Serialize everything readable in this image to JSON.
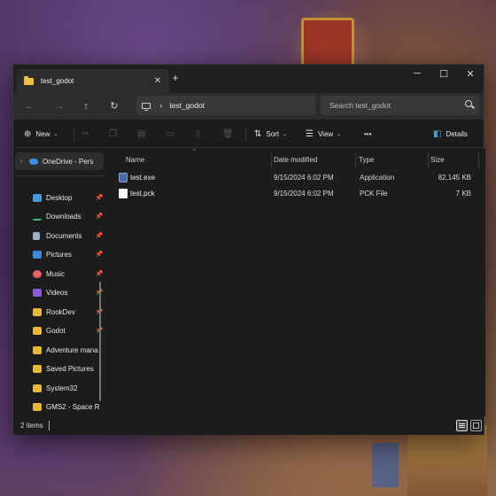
{
  "window": {
    "tab_title": "test_godot",
    "tab_close": "✕",
    "new_tab": "+",
    "minimize": "─",
    "maximize": "☐",
    "close": "✕"
  },
  "navbar": {
    "back": "←",
    "forward": "→",
    "up": "↑",
    "refresh": "↻",
    "breadcrumb_sep": "›",
    "breadcrumb": "test_godot",
    "search_placeholder": "Search test_godot"
  },
  "commandbar": {
    "new_label": "New",
    "sort_label": "Sort",
    "view_label": "View",
    "more_label": "•••",
    "details_label": "Details",
    "caret": "⌄"
  },
  "sidebar": {
    "onedrive": "OneDrive - Pers",
    "items": [
      {
        "label": "Desktop",
        "icon": "desktop-icon",
        "pinned": true
      },
      {
        "label": "Downloads",
        "icon": "downloads-icon",
        "pinned": true
      },
      {
        "label": "Documents",
        "icon": "documents-icon",
        "pinned": true
      },
      {
        "label": "Pictures",
        "icon": "pictures-icon",
        "pinned": true
      },
      {
        "label": "Music",
        "icon": "music-icon",
        "pinned": true
      },
      {
        "label": "Videos",
        "icon": "videos-icon",
        "pinned": true
      },
      {
        "label": "RookDev",
        "icon": "folder-icon",
        "pinned": true
      },
      {
        "label": "Godot",
        "icon": "folder-icon",
        "pinned": true
      },
      {
        "label": "Adventure mana",
        "icon": "folder-icon",
        "pinned": false
      },
      {
        "label": "Saved Pictures",
        "icon": "folder-icon",
        "pinned": false
      },
      {
        "label": "System32",
        "icon": "folder-icon",
        "pinned": false
      },
      {
        "label": "GMS2 - Space R",
        "icon": "folder-icon",
        "pinned": false
      }
    ],
    "pin_glyph": "📌"
  },
  "filelist": {
    "columns": {
      "name": "Name",
      "date": "Date modified",
      "type": "Type",
      "size": "Size"
    },
    "rows": [
      {
        "name": "test.exe",
        "date": "9/15/2024 6:02 PM",
        "type": "Application",
        "size": "82,145 KB",
        "icon": "exe-icon"
      },
      {
        "name": "test.pck",
        "date": "9/15/2024 6:02 PM",
        "type": "PCK File",
        "size": "7 KB",
        "icon": "file-icon"
      }
    ]
  },
  "status": {
    "item_count": "2 items"
  },
  "colors": {
    "window_bg": "#1c1c1c",
    "folder_yellow": "#e8b83a",
    "accent_blue": "#4a9ad8"
  }
}
